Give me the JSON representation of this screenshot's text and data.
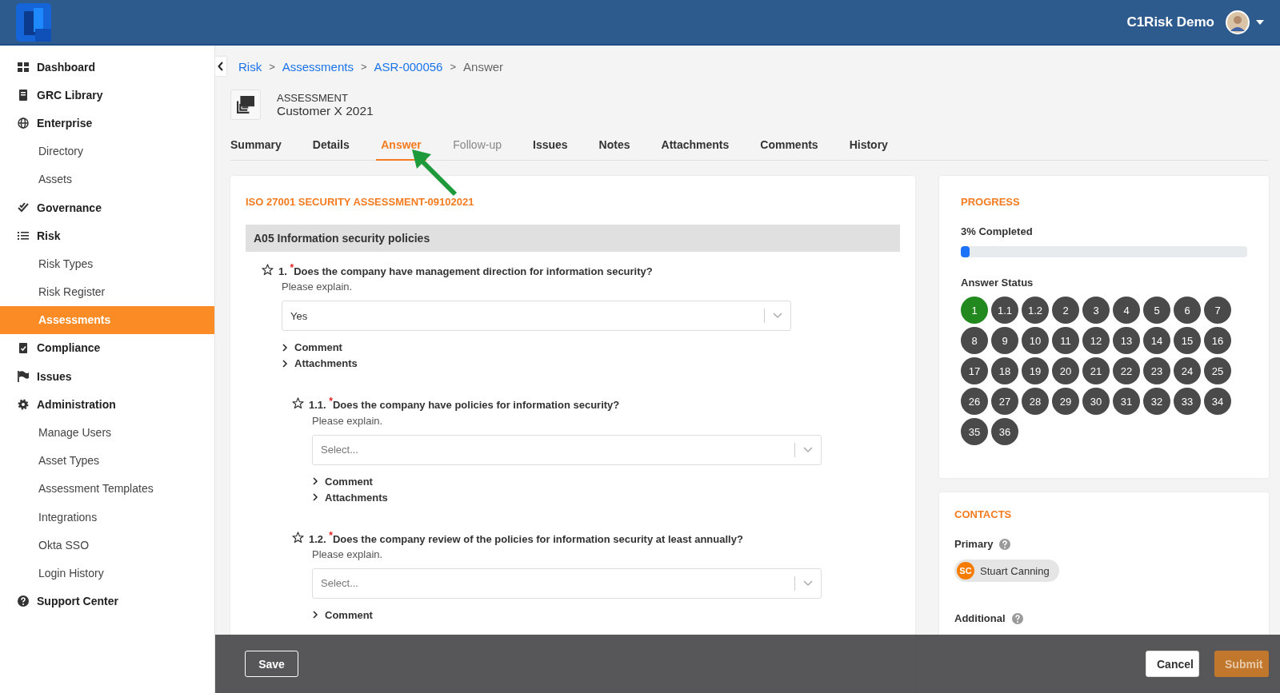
{
  "header": {
    "user_name": "C1Risk Demo"
  },
  "sidebar": {
    "items": [
      {
        "label": "Dashboard",
        "selected": false
      },
      {
        "label": "GRC Library",
        "selected": false
      },
      {
        "label": "Enterprise",
        "selected": false,
        "children": [
          {
            "label": "Directory",
            "selected": false
          },
          {
            "label": "Assets",
            "selected": false
          }
        ]
      },
      {
        "label": "Governance",
        "selected": false
      },
      {
        "label": "Risk",
        "selected": false,
        "children": [
          {
            "label": "Risk Types",
            "selected": false
          },
          {
            "label": "Risk Register",
            "selected": false
          },
          {
            "label": "Assessments",
            "selected": true
          }
        ]
      },
      {
        "label": "Compliance",
        "selected": false
      },
      {
        "label": "Issues",
        "selected": false
      },
      {
        "label": "Administration",
        "selected": false,
        "children": [
          {
            "label": "Manage Users",
            "selected": false
          },
          {
            "label": "Asset Types",
            "selected": false
          },
          {
            "label": "Assessment Templates",
            "selected": false
          },
          {
            "label": "Integrations",
            "selected": false
          },
          {
            "label": "Okta SSO",
            "selected": false
          },
          {
            "label": "Login History",
            "selected": false
          }
        ]
      },
      {
        "label": "Support Center",
        "selected": false
      }
    ]
  },
  "breadcrumb": [
    {
      "label": "Risk",
      "link": true
    },
    {
      "separator": ">",
      "label": "Assessments",
      "link": true
    },
    {
      "separator": ">",
      "label": "ASR-000056",
      "link": true
    },
    {
      "separator": ">",
      "label": "Answer",
      "link": false
    }
  ],
  "record": {
    "type": "ASSESSMENT",
    "name": "Customer X 2021"
  },
  "tabs": [
    {
      "label": "Summary",
      "selected": false,
      "disabled": false
    },
    {
      "label": "Details",
      "selected": false,
      "disabled": false
    },
    {
      "label": "Answer",
      "selected": true,
      "disabled": false
    },
    {
      "label": "Follow-up",
      "selected": false,
      "disabled": true
    },
    {
      "label": "Issues",
      "selected": false,
      "disabled": false
    },
    {
      "label": "Notes",
      "selected": false,
      "disabled": false
    },
    {
      "label": "Attachments",
      "selected": false,
      "disabled": false
    },
    {
      "label": "Comments",
      "selected": false,
      "disabled": false
    },
    {
      "label": "History",
      "selected": false,
      "disabled": false
    }
  ],
  "assessment": {
    "title": "ISO 27001 SECURITY ASSESSMENT-09102021",
    "section": "A05 Information security policies",
    "questions": [
      {
        "number": "1.",
        "required_mark": "*",
        "text": "Does the company have management direction for information security?",
        "starred": false,
        "hint": "Please explain.",
        "value": "Yes",
        "toggles": [
          {
            "label": "Comment",
            "expanded": false
          },
          {
            "label": "Attachments",
            "expanded": false
          }
        ],
        "children": [
          {
            "number": "1.1.",
            "required_mark": "*",
            "text": "Does the company have policies for information security?",
            "starred": false,
            "hint": "Please explain.",
            "placeholder": "Select...",
            "toggles": [
              {
                "label": "Comment",
                "expanded": false
              },
              {
                "label": "Attachments",
                "expanded": false
              }
            ]
          },
          {
            "number": "1.2.",
            "required_mark": "*",
            "text": "Does the company review of the policies for information security at least annually?",
            "starred": false,
            "hint": "Please explain.",
            "placeholder": "Select...",
            "toggles": [
              {
                "label": "Comment",
                "expanded": false
              }
            ]
          }
        ]
      }
    ]
  },
  "progress": {
    "title": "PROGRESS",
    "label": "3% Completed",
    "level": 0.03,
    "status_title": "Answer Status",
    "answers": [
      {
        "label": "1",
        "answered": true
      },
      {
        "label": "1.1",
        "answered": false
      },
      {
        "label": "1.2",
        "answered": false
      },
      {
        "label": "2",
        "answered": false
      },
      {
        "label": "3",
        "answered": false
      },
      {
        "label": "4",
        "answered": false
      },
      {
        "label": "5",
        "answered": false
      },
      {
        "label": "6",
        "answered": false
      },
      {
        "label": "7",
        "answered": false
      },
      {
        "label": "8",
        "answered": false
      },
      {
        "label": "9",
        "answered": false
      },
      {
        "label": "10",
        "answered": false
      },
      {
        "label": "11",
        "answered": false
      },
      {
        "label": "12",
        "answered": false
      },
      {
        "label": "13",
        "answered": false
      },
      {
        "label": "14",
        "answered": false
      },
      {
        "label": "15",
        "answered": false
      },
      {
        "label": "16",
        "answered": false
      },
      {
        "label": "17",
        "answered": false
      },
      {
        "label": "18",
        "answered": false
      },
      {
        "label": "19",
        "answered": false
      },
      {
        "label": "20",
        "answered": false
      },
      {
        "label": "21",
        "answered": false
      },
      {
        "label": "22",
        "answered": false
      },
      {
        "label": "23",
        "answered": false
      },
      {
        "label": "24",
        "answered": false
      },
      {
        "label": "25",
        "answered": false
      },
      {
        "label": "26",
        "answered": false
      },
      {
        "label": "27",
        "answered": false
      },
      {
        "label": "28",
        "answered": false
      },
      {
        "label": "29",
        "answered": false
      },
      {
        "label": "30",
        "answered": false
      },
      {
        "label": "31",
        "answered": false
      },
      {
        "label": "32",
        "answered": false
      },
      {
        "label": "33",
        "answered": false
      },
      {
        "label": "34",
        "answered": false
      },
      {
        "label": "35",
        "answered": false
      },
      {
        "label": "36",
        "answered": false
      }
    ]
  },
  "contacts": {
    "title": "CONTACTS",
    "primary_label": "Primary",
    "primary": [
      {
        "initials": "SC",
        "name": "Stuart Canning"
      }
    ],
    "additional_label": "Additional"
  },
  "footer": {
    "buttons": [
      {
        "label": "Save",
        "kind": "outline"
      },
      {
        "label": "Cancel",
        "kind": "secondary"
      },
      {
        "label": "Submit",
        "kind": "primary",
        "disabled": true
      }
    ]
  }
}
